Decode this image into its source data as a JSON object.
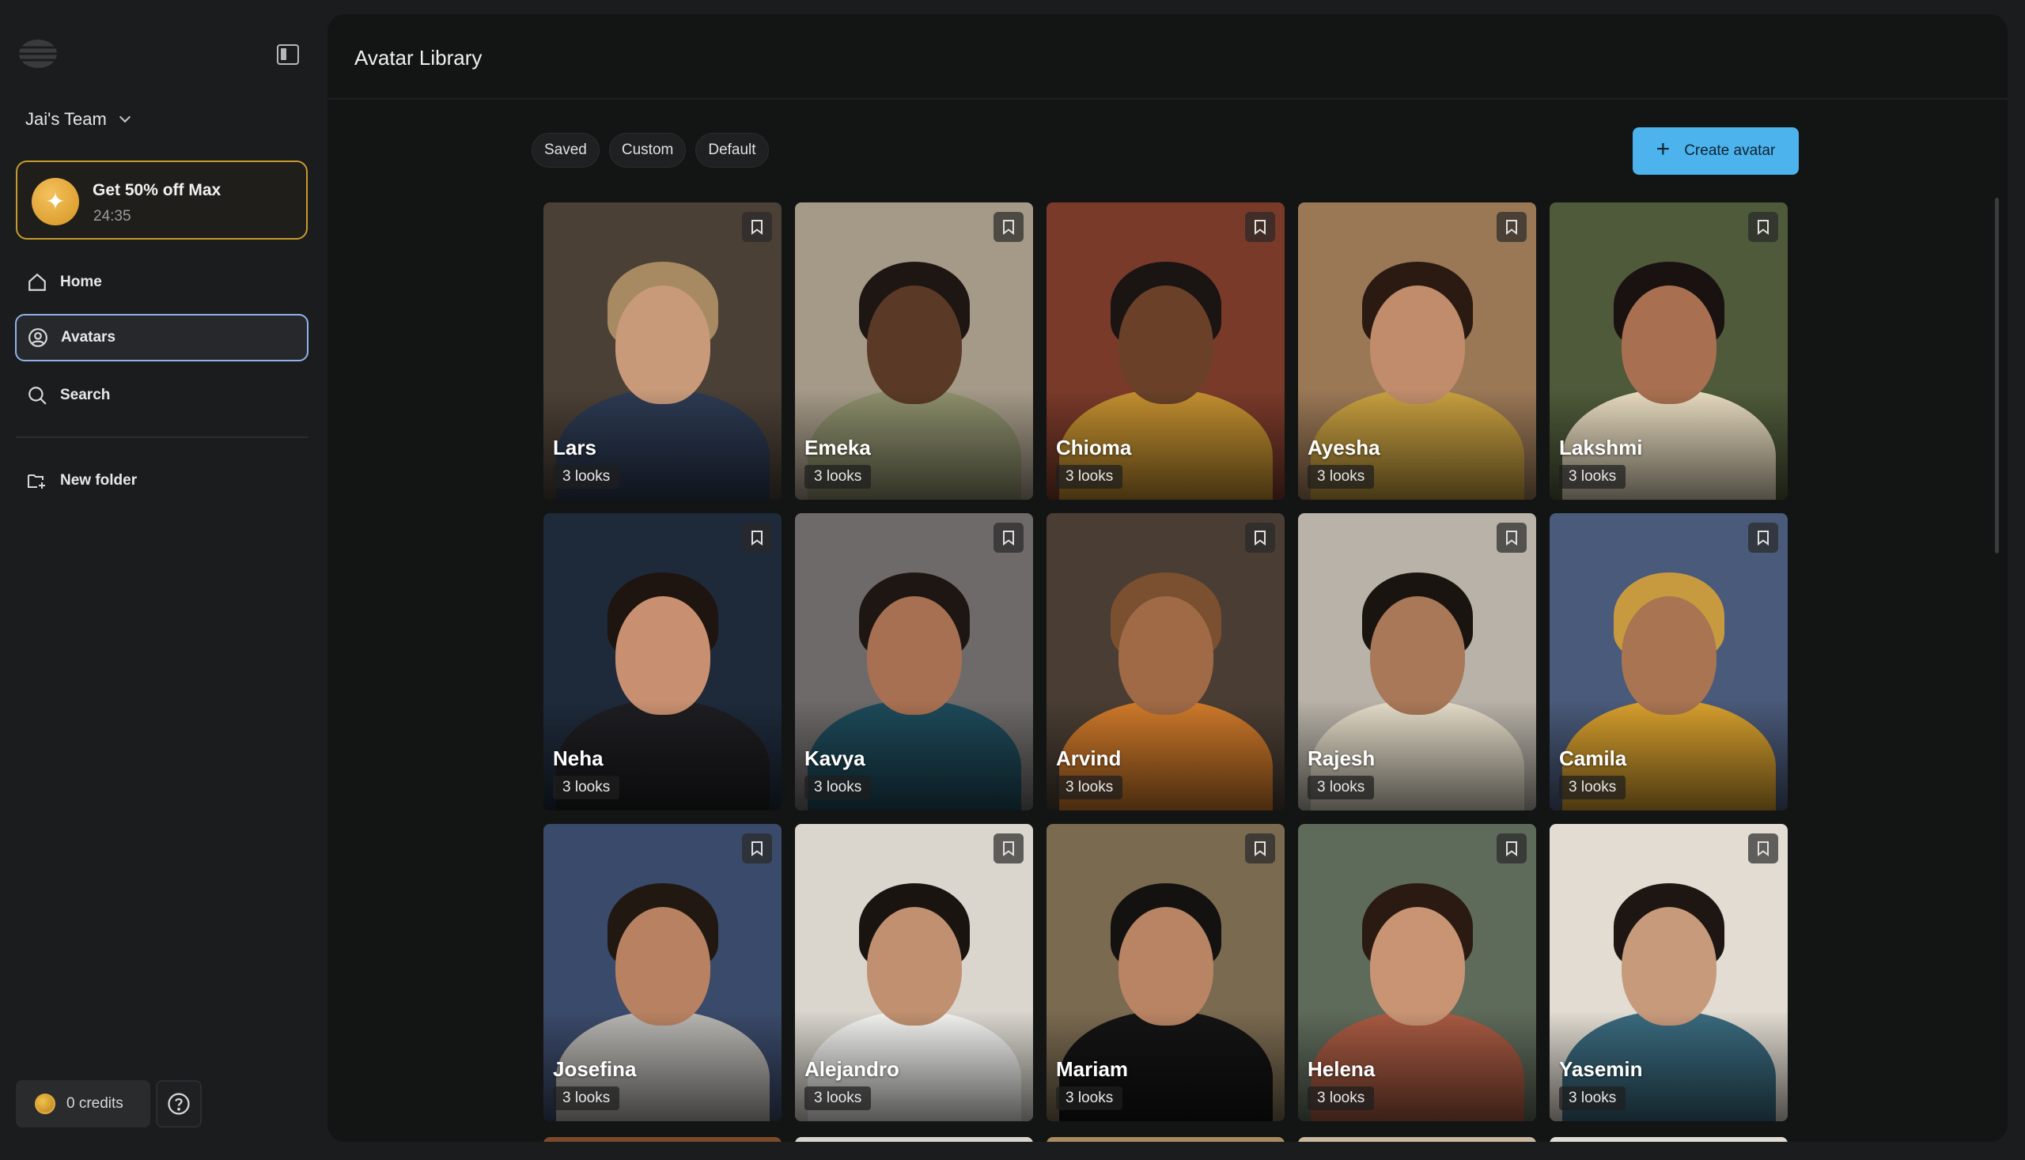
{
  "sidebar": {
    "team_name": "Jai's Team",
    "promo": {
      "title": "Get 50% off Max",
      "timer": "24:35"
    },
    "nav": [
      {
        "label": "Home",
        "icon": "home-icon"
      },
      {
        "label": "Avatars",
        "icon": "user-circle-icon",
        "active": true
      },
      {
        "label": "Search",
        "icon": "search-icon"
      }
    ],
    "new_folder_label": "New folder",
    "credits_label": "0 credits"
  },
  "main": {
    "title": "Avatar Library",
    "filters": [
      "Saved",
      "Custom",
      "Default"
    ],
    "create_button_label": "Create avatar",
    "avatars": [
      {
        "name": "Lars",
        "looks": "3 looks",
        "bg": "#4b4036",
        "skin": "#c89a7a",
        "hair": "#a88a62",
        "cloth": "#2c3a52"
      },
      {
        "name": "Emeka",
        "looks": "3 looks",
        "bg": "#a59a88",
        "skin": "#5a3a26",
        "hair": "#1e1612",
        "cloth": "#8d8f6c"
      },
      {
        "name": "Chioma",
        "looks": "3 looks",
        "bg": "#7a3a2a",
        "skin": "#6a4028",
        "hair": "#1a1412",
        "cloth": "#c49030"
      },
      {
        "name": "Ayesha",
        "looks": "3 looks",
        "bg": "#9a7856",
        "skin": "#c08c6c",
        "hair": "#2a1a12",
        "cloth": "#c8a040"
      },
      {
        "name": "Lakshmi",
        "looks": "3 looks",
        "bg": "#4e5a3a",
        "skin": "#a87050",
        "hair": "#1a1210",
        "cloth": "#e8dcc0"
      },
      {
        "name": "Neha",
        "looks": "3 looks",
        "bg": "#1e2a3a",
        "skin": "#c89070",
        "hair": "#1e1410",
        "cloth": "#1e1e22"
      },
      {
        "name": "Kavya",
        "looks": "3 looks",
        "bg": "#6e6a6a",
        "skin": "#a87052",
        "hair": "#1e1612",
        "cloth": "#1e4a5a"
      },
      {
        "name": "Arvind",
        "looks": "3 looks",
        "bg": "#4a3e34",
        "skin": "#a06a46",
        "hair": "#7a5030",
        "cloth": "#d07a2a"
      },
      {
        "name": "Rajesh",
        "looks": "3 looks",
        "bg": "#b8b2a8",
        "skin": "#a87858",
        "hair": "#1a1410",
        "cloth": "#e4dcc8"
      },
      {
        "name": "Camila",
        "looks": "3 looks",
        "bg": "#4a5a7a",
        "skin": "#a87452",
        "hair": "#c89a40",
        "cloth": "#d8a02e"
      },
      {
        "name": "Josefina",
        "looks": "3 looks",
        "bg": "#3a4a6a",
        "skin": "#b88262",
        "hair": "#221812",
        "cloth": "#b8b6b2"
      },
      {
        "name": "Alejandro",
        "looks": "3 looks",
        "bg": "#dad6ce",
        "skin": "#c09070",
        "hair": "#1a1410",
        "cloth": "#f2f2f0"
      },
      {
        "name": "Mariam",
        "looks": "3 looks",
        "bg": "#7a6a50",
        "skin": "#b88464",
        "hair": "#141210",
        "cloth": "#151414"
      },
      {
        "name": "Helena",
        "looks": "3 looks",
        "bg": "#5e6a5a",
        "skin": "#c89474",
        "hair": "#2a1a12",
        "cloth": "#a85a42"
      },
      {
        "name": "Yasemin",
        "looks": "3 looks",
        "bg": "#e2dcd2",
        "skin": "#c89a7c",
        "hair": "#1e1612",
        "cloth": "#3a6a7e"
      }
    ],
    "peek_colors": [
      "#7a4a2a",
      "#d8d4cc",
      "#a88a60",
      "#c8b8a0",
      "#e0dcd4"
    ]
  }
}
